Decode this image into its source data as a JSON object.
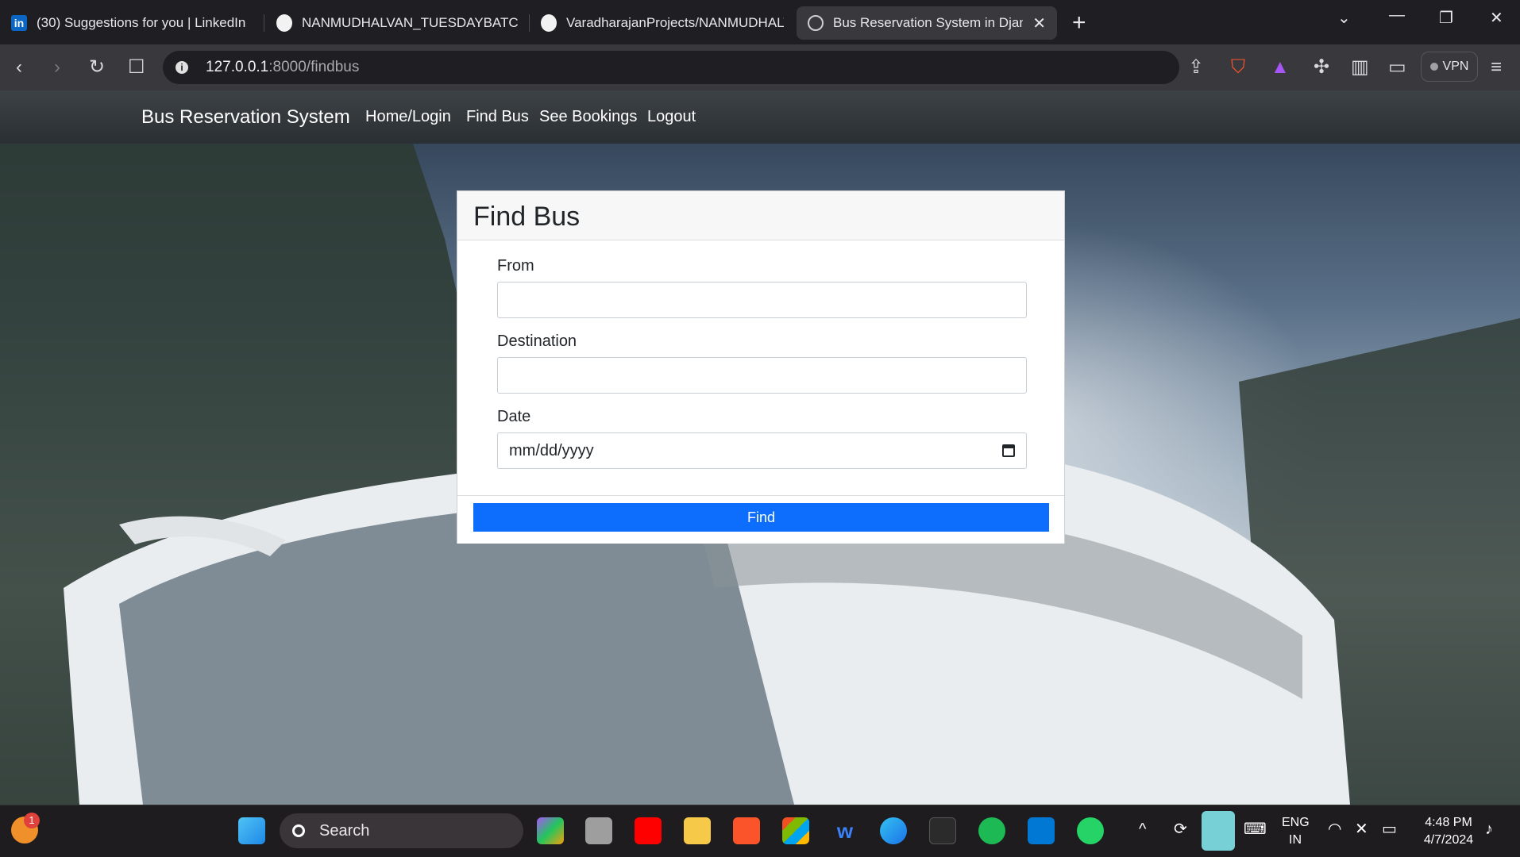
{
  "tabs": [
    {
      "title": "(30) Suggestions for you | LinkedIn",
      "icon": "linkedin-icon"
    },
    {
      "title": "NANMUDHALVAN_TUESDAYBATCH_",
      "icon": "github-icon"
    },
    {
      "title": "VaradharajanProjects/NANMUDHALV",
      "icon": "github-icon"
    },
    {
      "title": "Bus Reservation System in Djang",
      "icon": "globe-icon",
      "active": true
    }
  ],
  "address_bar": {
    "host": "127.0.0.1",
    "path": ":8000/findbus"
  },
  "vpn_label": "VPN",
  "navbar": {
    "brand": "Bus Reservation System",
    "links": [
      "Home/Login",
      "Find Bus",
      "See Bookings",
      "Logout"
    ]
  },
  "form": {
    "title": "Find Bus",
    "from_label": "From",
    "from_value": "",
    "destination_label": "Destination",
    "destination_value": "",
    "date_label": "Date",
    "date_placeholder": "mm/dd/yyyy",
    "submit_label": "Find"
  },
  "taskbar": {
    "search_label": "Search",
    "badge_count": "1",
    "lang_line1": "ENG",
    "lang_line2": "IN",
    "time": "4:48 PM",
    "date": "4/7/2024"
  },
  "colors": {
    "primary_button": "#0d6efd",
    "navbar": "#343a40"
  }
}
